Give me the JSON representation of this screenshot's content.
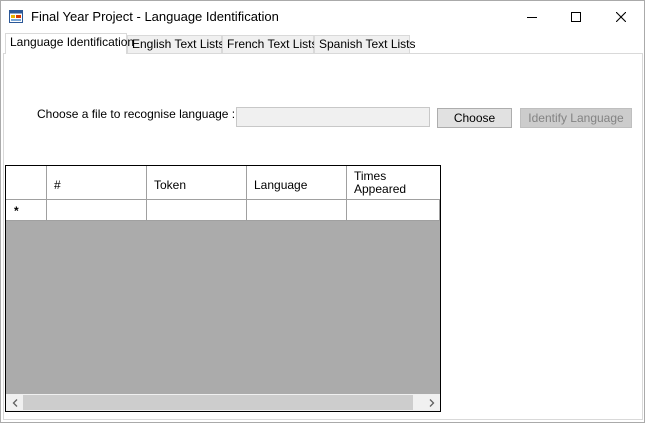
{
  "window": {
    "title": "Final Year Project - Language Identification",
    "icon": "app-form-icon",
    "controls": [
      "minimize-icon",
      "maximize-icon",
      "close-icon"
    ]
  },
  "tabs": [
    {
      "label": "Language Identification",
      "active": true
    },
    {
      "label": "English Text Lists",
      "active": false
    },
    {
      "label": "French Text Lists",
      "active": false
    },
    {
      "label": "Spanish Text Lists",
      "active": false
    }
  ],
  "form": {
    "choose_label": "Choose a file to recognise language :",
    "file_value": "",
    "choose_button": "Choose",
    "identify_button": "Identify Language",
    "identify_enabled": false
  },
  "grid": {
    "columns": [
      "#",
      "Token",
      "Language",
      "Times Appeared"
    ],
    "new_row_marker": "*",
    "rows": []
  },
  "colors": {
    "grid_background": "#ababab",
    "disabled_button_bg": "#cccccc",
    "disabled_button_text": "#838383",
    "input_bg": "#f0f0f0"
  }
}
